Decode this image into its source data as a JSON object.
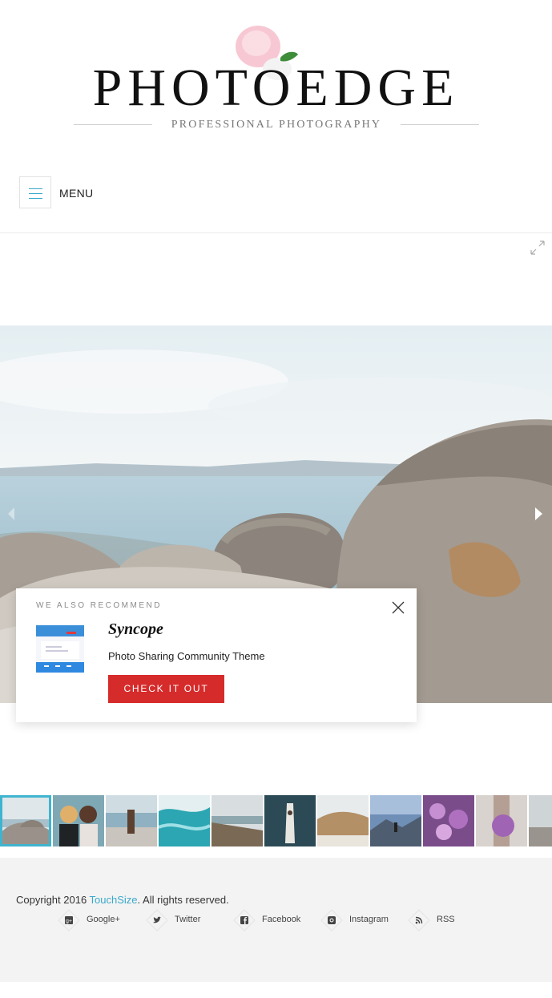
{
  "header": {
    "logo_title": "PHOTOEDGE",
    "logo_subtitle": "PROFESSIONAL PHOTOGRAPHY"
  },
  "nav": {
    "menu_label": "MENU"
  },
  "recommend": {
    "heading": "WE ALSO RECOMMEND",
    "title": "Syncope",
    "description": "Photo Sharing Community Theme",
    "cta_label": "CHECK IT OUT"
  },
  "footer": {
    "copyright_prefix": "Copyright 2016 ",
    "copyright_link": "TouchSize",
    "copyright_suffix": ". All rights reserved.",
    "social": [
      {
        "label": "Google+",
        "icon": "google-plus-icon"
      },
      {
        "label": "Twitter",
        "icon": "twitter-icon"
      },
      {
        "label": "Facebook",
        "icon": "facebook-icon"
      },
      {
        "label": "Instagram",
        "icon": "instagram-icon"
      },
      {
        "label": "RSS",
        "icon": "rss-icon"
      }
    ]
  },
  "colors": {
    "accent": "#3aa9c9",
    "cta": "#d62b2b",
    "footer_bg": "#f3f3f3"
  }
}
